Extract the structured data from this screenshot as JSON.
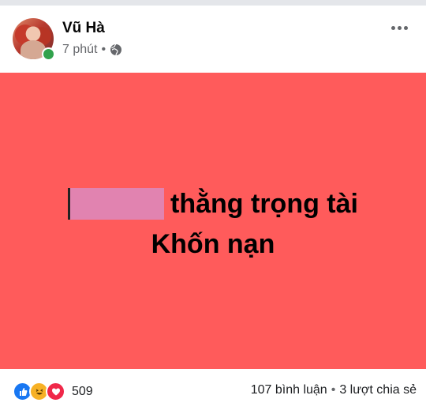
{
  "author": {
    "name": "Vũ Hà",
    "time": "7 phút",
    "separator": "•",
    "audience_icon": "globe-icon"
  },
  "post": {
    "background_color": "#ff5b5b",
    "text_line_1": "thằng trọng tài",
    "text_line_2": "Khốn nạn"
  },
  "stats": {
    "reaction_icons": [
      "like-icon",
      "haha-icon",
      "love-icon"
    ],
    "reaction_count": "509",
    "comments": "107 bình luận",
    "separator": "•",
    "shares": "3 lượt chia sẻ"
  }
}
